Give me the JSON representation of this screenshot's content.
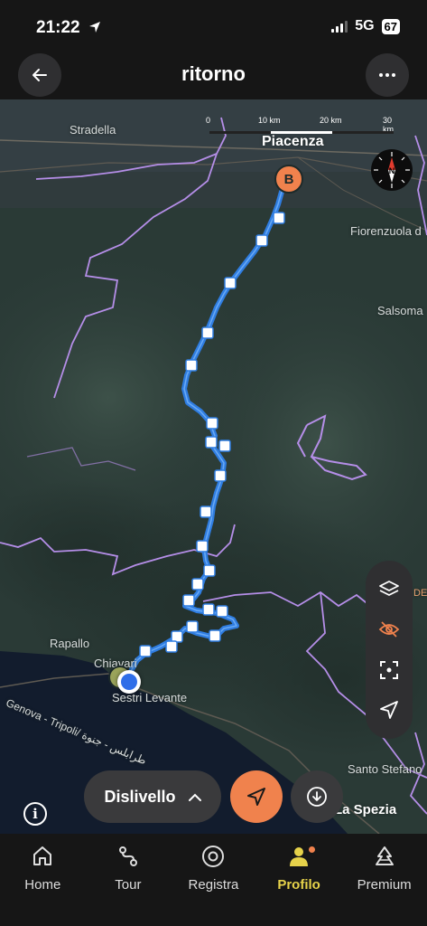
{
  "status_bar": {
    "time": "21:22",
    "network": "5G",
    "battery": "67"
  },
  "header": {
    "title": "ritorno"
  },
  "map": {
    "scale": {
      "labels": [
        "0",
        "10 km",
        "20 km",
        "30 km"
      ]
    },
    "places": {
      "stradella": "Stradella",
      "piacenza": "Piacenza",
      "fiorenzuola": "Fiorenzuola d",
      "salsoma": "Salsoma",
      "rapallo": "Rapallo",
      "chiavari": "Chiavari",
      "sestri": "Sestri Levante",
      "genova_road": "Genova - Tripoli/ طرابلس - جنوة",
      "santo_stefano": "Santo Stefano",
      "la_spezia": "La Spezia",
      "de_fragment": "DE"
    },
    "end_marker": "B",
    "compass_label": "N",
    "route_color": "#2f7de1",
    "boundary_color": "#b58ee8"
  },
  "controls": {
    "elevation_label": "Dislivello",
    "info_label": "i"
  },
  "bottom_nav": {
    "home": "Home",
    "tour": "Tour",
    "registra": "Registra",
    "profilo": "Profilo",
    "premium": "Premium"
  },
  "accent": "#f0824d",
  "active_nav_color": "#e6d24a"
}
